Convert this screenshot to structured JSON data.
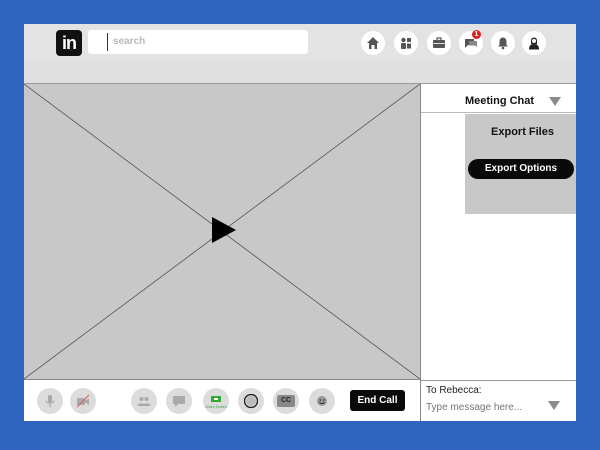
{
  "header": {
    "logo_text": "in",
    "search_placeholder": "search",
    "icons": [
      "home-icon",
      "people-icon",
      "briefcase-icon",
      "messages-icon",
      "bell-icon",
      "profile-icon"
    ],
    "message_badge": "1"
  },
  "controls": {
    "icons": [
      "microphone-icon",
      "camera-off-icon",
      "participants-icon",
      "chat-icon",
      "share-screen-icon",
      "record-icon",
      "captions-icon",
      "reactions-icon"
    ],
    "share_label": "Share Screen",
    "cc_label": "CC",
    "end_call_label": "End Call"
  },
  "chat": {
    "title": "Meeting Chat",
    "export_title": "Export Files",
    "export_button": "Export Options",
    "to_label": "To Rebecca:",
    "message_placeholder": "Type message here..."
  },
  "colors": {
    "background": "#2f63c0",
    "placeholder_gray": "#c8c8c8",
    "button_black": "#0a0a0a",
    "badge_red": "#d22222"
  }
}
